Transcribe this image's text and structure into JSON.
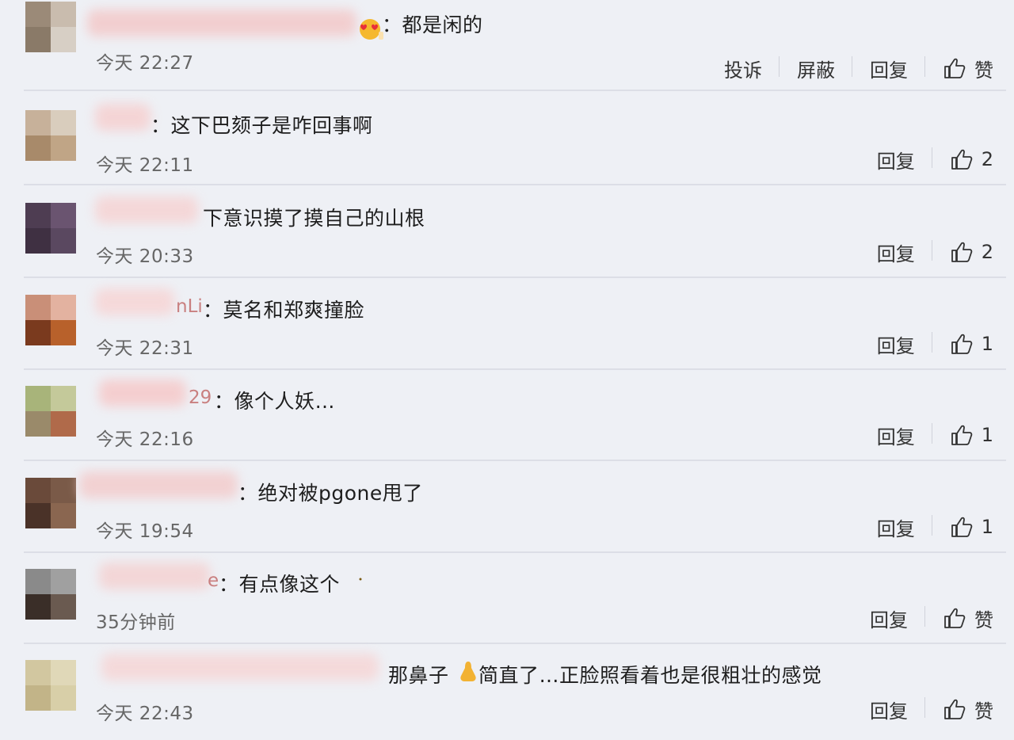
{
  "comments": [
    {
      "name_visible": "",
      "text": "：都是闲的",
      "time": "今天 22:27",
      "actions": {
        "report": "投诉",
        "block": "屏蔽",
        "reply": "回复",
        "like": "赞"
      }
    },
    {
      "name_visible": "",
      "text": "：这下巴颏子是咋回事啊",
      "time": "今天 22:11",
      "actions": {
        "reply": "回复",
        "like_count": "2"
      }
    },
    {
      "name_visible": "",
      "text": "下意识摸了摸自己的山根",
      "time": "今天 20:33",
      "actions": {
        "reply": "回复",
        "like_count": "2"
      }
    },
    {
      "name_visible": "nLi",
      "text": "：莫名和郑爽撞脸",
      "time": "今天 22:31",
      "actions": {
        "reply": "回复",
        "like_count": "1"
      }
    },
    {
      "name_visible": "29",
      "text": "：像个人妖…",
      "time": "今天 22:16",
      "actions": {
        "reply": "回复",
        "like_count": "1"
      }
    },
    {
      "name_visible": "",
      "text": "：绝对被pgone甩了",
      "time": "今天 19:54",
      "actions": {
        "reply": "回复",
        "like_count": "1"
      }
    },
    {
      "name_visible": "e",
      "text": "：有点像这个",
      "time": "35分钟前",
      "actions": {
        "reply": "回复",
        "like": "赞"
      }
    },
    {
      "name_visible": "",
      "text_before": "那鼻子",
      "text_after": "简直了…正脸照看着也是很粗壮的感觉",
      "time": "今天 22:43",
      "actions": {
        "reply": "回复",
        "like": "赞"
      }
    }
  ],
  "icons": {
    "like": "thumbs-up-icon",
    "emoji_heart_eyes": "heart-eyes-emoji-icon",
    "emoji_moon": "crescent-moon-emoji-icon",
    "emoji_nose": "nose-emoji-icon"
  },
  "colors": {
    "background": "#eef0f5",
    "divider": "#dcdee6",
    "time_text": "#666666",
    "username_fragment": "#c98080"
  }
}
